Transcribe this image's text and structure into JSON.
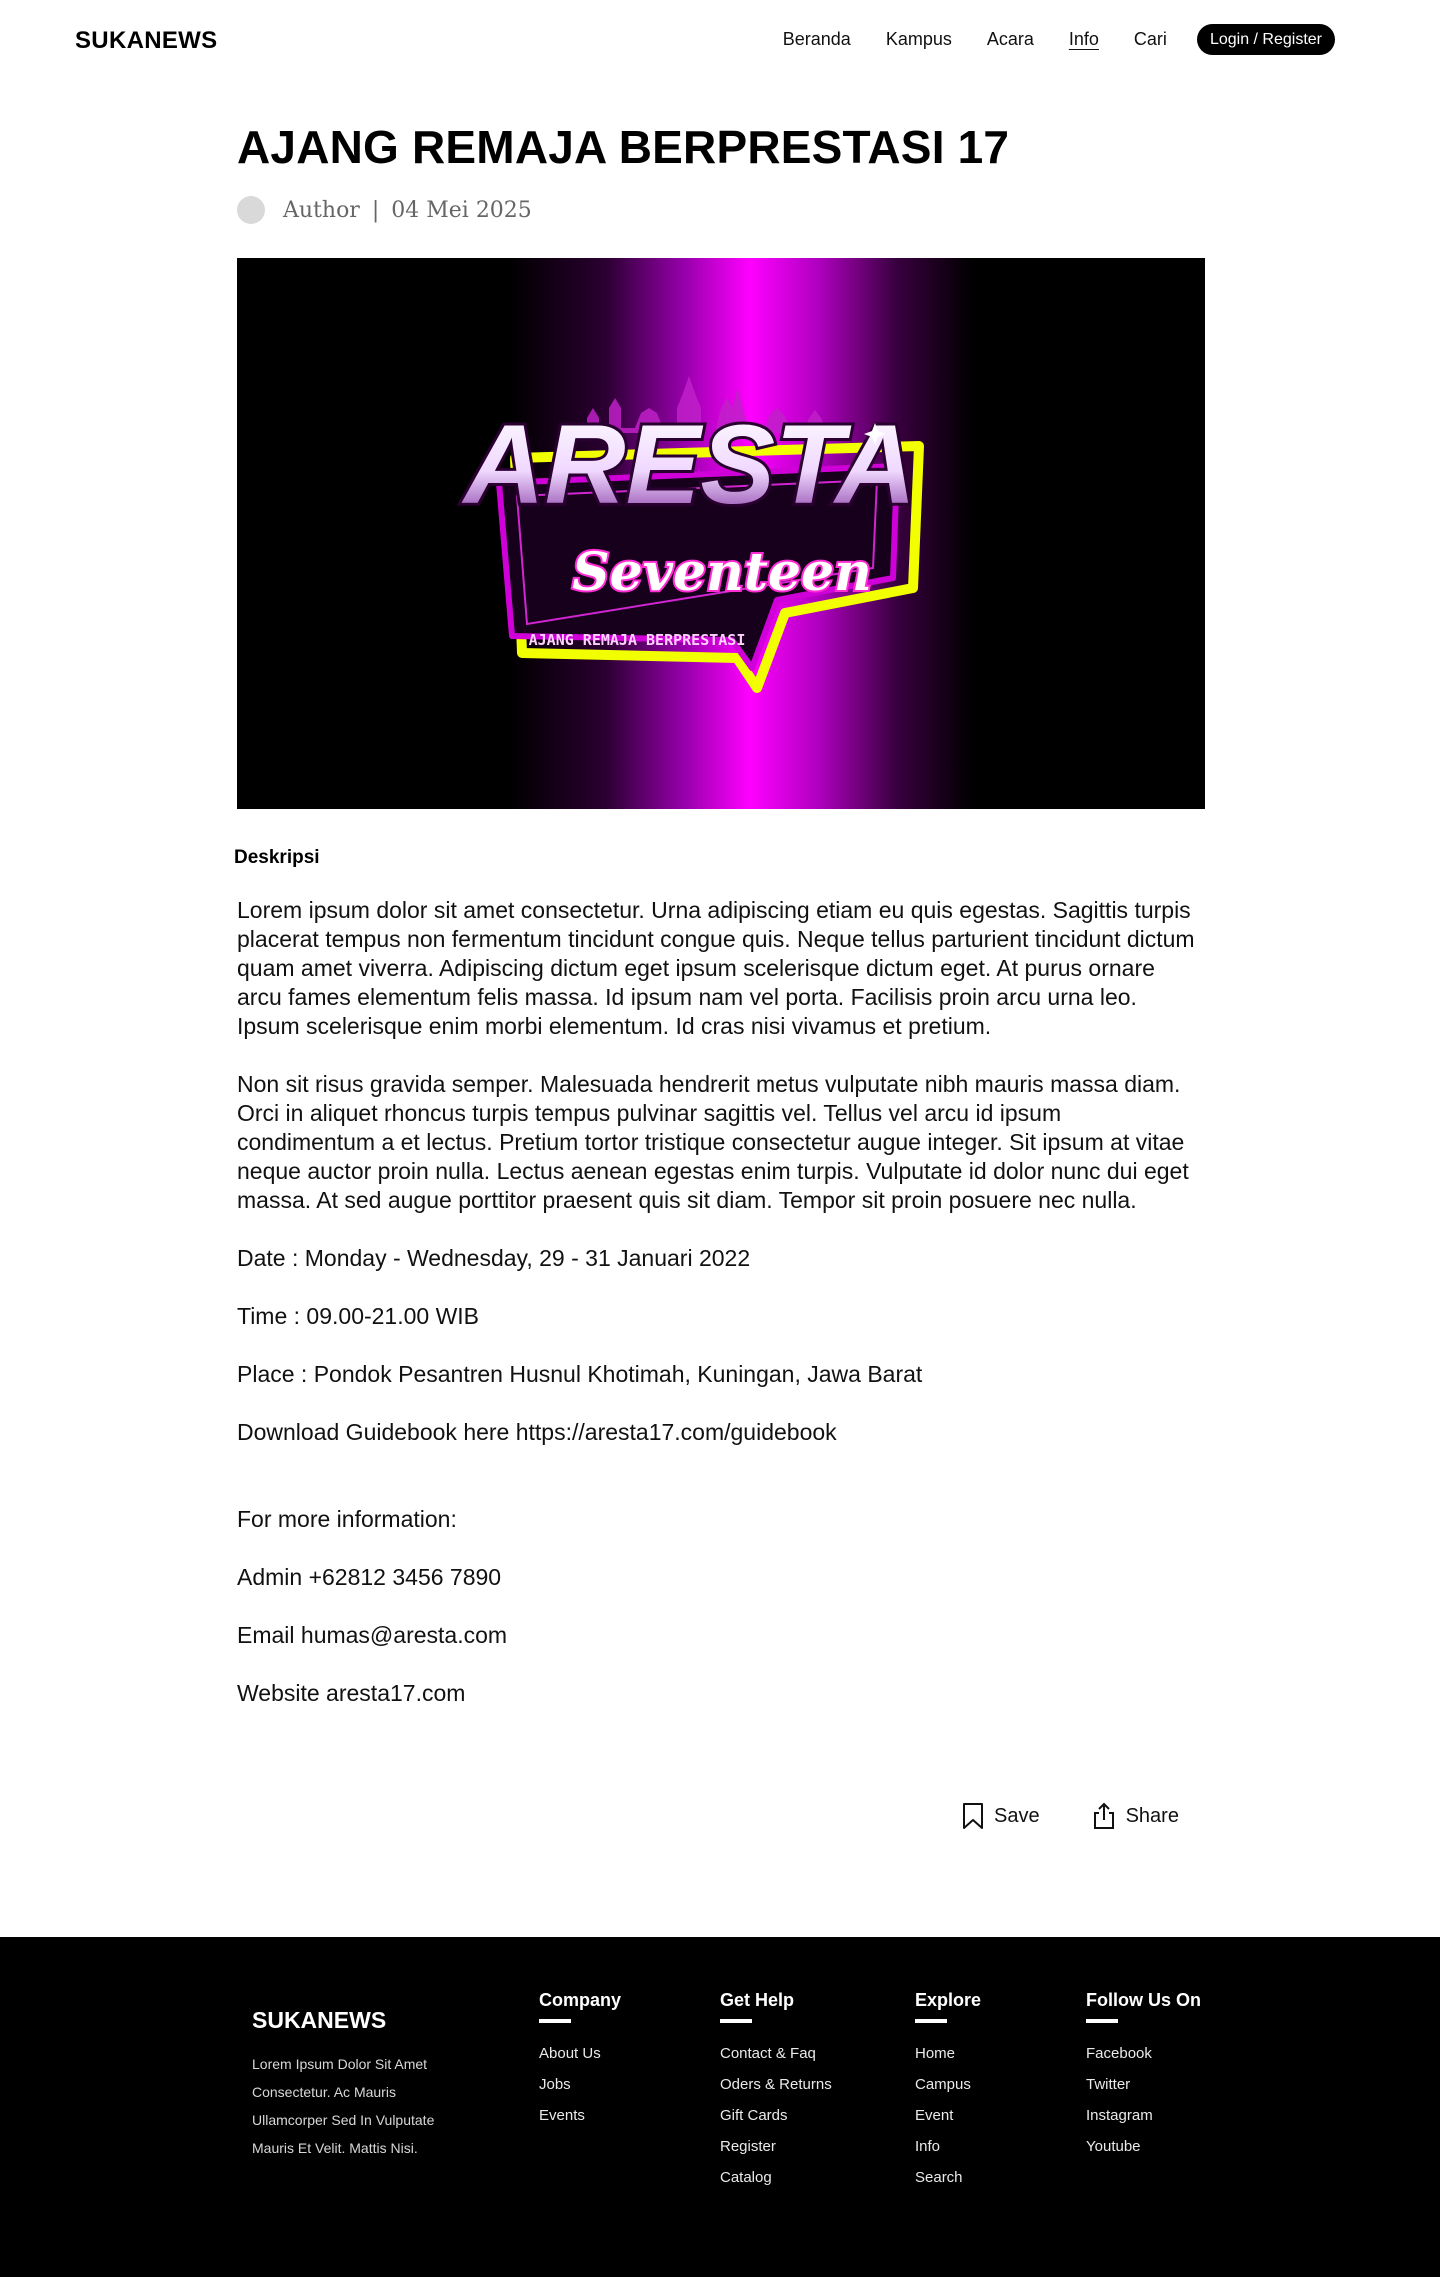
{
  "header": {
    "brand": "SUKANEWS",
    "nav": [
      "Beranda",
      "Kampus",
      "Acara",
      "Info",
      "Cari"
    ],
    "active_nav": "Info",
    "login_label": "Login / Register"
  },
  "article": {
    "title": "AJANG REMAJA BERPRESTASI 17",
    "author": "Author",
    "separator": "|",
    "date": "04 Mei 2025",
    "hero": {
      "logo_main": "ARESTA",
      "logo_script": "Seventeen",
      "logo_tagline": "AJANG REMAJA BERPRESTASI",
      "colors": {
        "beam": "#ff00ff",
        "accent_yellow": "#f2ff00",
        "outline": "#d000d8"
      }
    },
    "desc_label": "Deskripsi",
    "paragraph1": "Lorem ipsum dolor sit amet consectetur. Urna adipiscing etiam eu quis egestas. Sagittis turpis placerat tempus non fermentum tincidunt congue quis. Neque tellus parturient tincidunt dictum quam amet viverra. Adipiscing dictum eget ipsum scelerisque dictum eget. At purus ornare arcu fames elementum felis massa. Id ipsum nam vel porta. Facilisis proin arcu urna leo. Ipsum scelerisque enim morbi elementum. Id cras nisi vivamus et pretium.",
    "paragraph2": "Non sit risus gravida semper. Malesuada hendrerit metus vulputate nibh mauris massa diam. Orci in aliquet rhoncus turpis tempus pulvinar sagittis vel. Tellus vel arcu id ipsum condimentum a et lectus. Pretium tortor tristique consectetur augue integer. Sit ipsum at vitae neque auctor proin nulla. Lectus aenean egestas enim turpis. Vulputate id dolor nunc dui eget massa. At sed augue porttitor praesent quis sit diam. Tempor sit proin posuere nec nulla.",
    "date_line": "Date : Monday - Wednesday, 29 - 31 Januari 2022",
    "time_line": "Time : 09.00-21.00 WIB",
    "place_line": "Place : Pondok Pesantren Husnul Khotimah, Kuningan, Jawa Barat",
    "guidebook_line": "Download Guidebook here https://aresta17.com/guidebook",
    "more_info": "For more information:",
    "admin_line": "Admin +62812 3456 7890",
    "email_line": "Email humas@aresta.com",
    "website_line": "Website aresta17.com",
    "save_label": "Save",
    "share_label": "Share"
  },
  "footer": {
    "brand": "SUKANEWS",
    "about": "Lorem Ipsum Dolor Sit Amet Consectetur. Ac Mauris Ullamcorper Sed In Vulputate Mauris Et Velit. Mattis Nisi.",
    "columns": [
      {
        "heading": "Company",
        "links": [
          "About Us",
          "Jobs",
          "Events"
        ]
      },
      {
        "heading": "Get Help",
        "links": [
          "Contact & Faq",
          "Oders & Returns",
          "Gift Cards",
          "Register",
          "Catalog"
        ]
      },
      {
        "heading": "Explore",
        "links": [
          "Home",
          "Campus",
          "Event",
          "Info",
          "Search"
        ]
      },
      {
        "heading": "Follow Us On",
        "links": [
          "Facebook",
          "Twitter",
          "Instagram",
          "Youtube"
        ]
      }
    ]
  }
}
